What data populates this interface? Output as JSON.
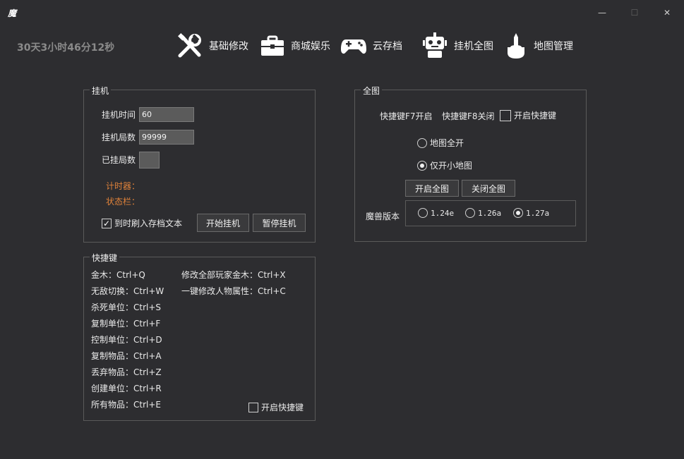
{
  "window": {
    "app_icon_text": "魔",
    "minimize": "—",
    "maximize": "☐",
    "close": "✕"
  },
  "status": {
    "timer": "30天3小时46分12秒"
  },
  "nav": [
    {
      "label": "基础修改",
      "icon": "tools-icon"
    },
    {
      "label": "商城娱乐",
      "icon": "toolbox-icon"
    },
    {
      "label": "云存档",
      "icon": "gamepad-icon"
    },
    {
      "label": "挂机全图",
      "icon": "robot-icon"
    },
    {
      "label": "地图管理",
      "icon": "brush-icon"
    }
  ],
  "afk": {
    "title": "挂机",
    "time_label": "挂机时间",
    "time_value": "60",
    "rounds_label": "挂机局数",
    "rounds_value": "99999",
    "done_label": "已挂局数",
    "done_value": "",
    "timer_label": "计时器：",
    "status_label": "状态栏：",
    "save_text_label": "到时刷入存档文本",
    "save_text_checked": true,
    "start_button": "开始挂机",
    "pause_button": "暂停挂机"
  },
  "hotkeys": {
    "title": "快捷键",
    "left": [
      "金木：Ctrl+Q",
      "无敌切换：Ctrl+W",
      "杀死单位：Ctrl+S",
      "复制单位：Ctrl+F",
      "控制单位：Ctrl+D",
      "复制物品：Ctrl+A",
      "丢弃物品：Ctrl+Z",
      "创建单位：Ctrl+R",
      "所有物品：Ctrl+E"
    ],
    "right": [
      "修改全部玩家金木：Ctrl+X",
      "一键修改人物属性：Ctrl+C"
    ],
    "enable_label": "开启快捷键",
    "enable_checked": false
  },
  "fullmap": {
    "title": "全图",
    "f7_label": "快捷键F7开启",
    "f8_label": "快捷键F8关闭",
    "enable_hotkey_label": "开启快捷键",
    "enable_hotkey_checked": false,
    "option_all": "地图全开",
    "option_minimap": "仅开小地图",
    "selected_option": "minimap",
    "open_button": "开启全图",
    "close_button": "关闭全图",
    "version_label": "魔兽版本",
    "versions": [
      "1.24e",
      "1.26a",
      "1.27a"
    ],
    "selected_version": "1.27a"
  },
  "colors": {
    "background": "#2d2d30",
    "accent_orange": "#e0823a",
    "border": "#5a5a5a"
  }
}
